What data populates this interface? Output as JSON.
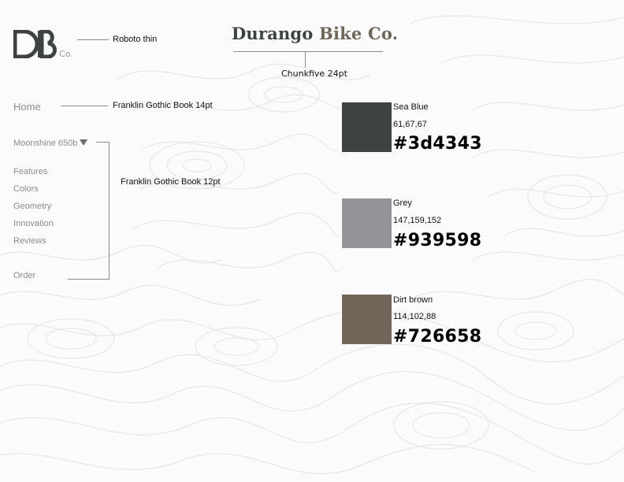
{
  "logo": {
    "co": "Co."
  },
  "brand": {
    "part1": "Durango ",
    "part2": "Bike Co."
  },
  "notes": {
    "logo_font": "Roboto thin",
    "title_font": "Chunkfive 24pt",
    "home_font": "Franklin Gothic Book 14pt",
    "nav_font": "Franklin Gothic Book 12pt"
  },
  "nav": {
    "home": "Home",
    "model": "Moonshine 650b",
    "items": [
      "Features",
      "Colors",
      "Geometry",
      "Innovation",
      "Reviews"
    ],
    "order": "Order"
  },
  "swatches": [
    {
      "name": "Sea Blue",
      "rgb": "61,67,67",
      "hex": "#3d4343",
      "color": "#3d4343"
    },
    {
      "name": "Grey",
      "rgb": "147,159,152",
      "hex": "#939598",
      "color": "#939598"
    },
    {
      "name": "Dirt brown",
      "rgb": "114,102,88",
      "hex": "#726658",
      "color": "#726658"
    }
  ],
  "colors": {
    "background": "#fbfbfb",
    "topo_line": "#e3e3e3",
    "nav_text": "#8c8c8c"
  }
}
